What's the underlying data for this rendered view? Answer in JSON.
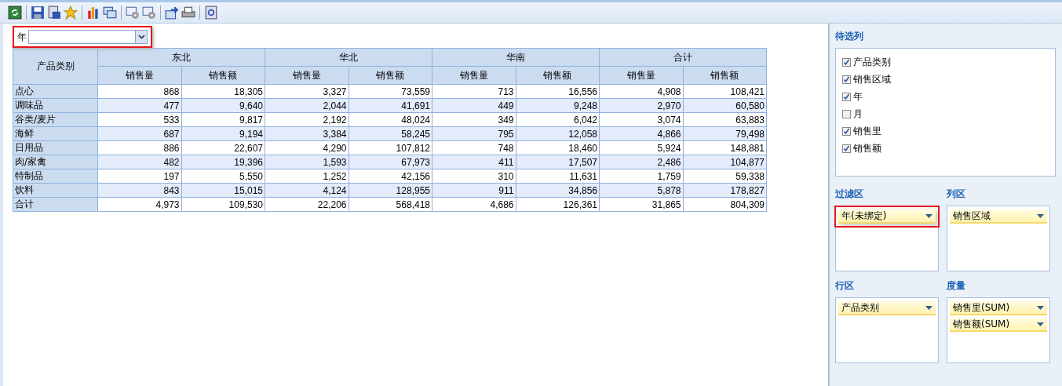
{
  "filter": {
    "label": "年",
    "highlighted": true
  },
  "table": {
    "corner": "产品类别",
    "groups": [
      {
        "label": "东北",
        "columns": [
          "销售量",
          "销售额"
        ]
      },
      {
        "label": "华北",
        "columns": [
          "销售量",
          "销售额"
        ]
      },
      {
        "label": "华南",
        "columns": [
          "销售量",
          "销售额"
        ]
      },
      {
        "label": "合计",
        "columns": [
          "销售量",
          "销售额"
        ]
      }
    ],
    "rows": [
      {
        "label": "点心",
        "cells": [
          "868",
          "18,305",
          "3,327",
          "73,559",
          "713",
          "16,556",
          "4,908",
          "108,421"
        ]
      },
      {
        "label": "调味品",
        "cells": [
          "477",
          "9,640",
          "2,044",
          "41,691",
          "449",
          "9,248",
          "2,970",
          "60,580"
        ]
      },
      {
        "label": "谷类/麦片",
        "cells": [
          "533",
          "9,817",
          "2,192",
          "48,024",
          "349",
          "6,042",
          "3,074",
          "63,883"
        ]
      },
      {
        "label": "海鲜",
        "cells": [
          "687",
          "9,194",
          "3,384",
          "58,245",
          "795",
          "12,058",
          "4,866",
          "79,498"
        ]
      },
      {
        "label": "日用品",
        "cells": [
          "886",
          "22,607",
          "4,290",
          "107,812",
          "748",
          "18,460",
          "5,924",
          "148,881"
        ]
      },
      {
        "label": "肉/家禽",
        "cells": [
          "482",
          "19,396",
          "1,593",
          "67,973",
          "411",
          "17,507",
          "2,486",
          "104,877"
        ]
      },
      {
        "label": "特制品",
        "cells": [
          "197",
          "5,550",
          "1,252",
          "42,156",
          "310",
          "11,631",
          "1,759",
          "59,338"
        ]
      },
      {
        "label": "饮料",
        "cells": [
          "843",
          "15,015",
          "4,124",
          "128,955",
          "911",
          "34,856",
          "5,878",
          "178,827"
        ]
      },
      {
        "label": "合计",
        "cells": [
          "4,973",
          "109,530",
          "22,206",
          "568,418",
          "4,686",
          "126,361",
          "31,865",
          "804,309"
        ]
      }
    ]
  },
  "fields": {
    "title": "待选列",
    "items": [
      {
        "label": "产品类别",
        "checked": true
      },
      {
        "label": "销售区域",
        "checked": true
      },
      {
        "label": "年",
        "checked": true
      },
      {
        "label": "月",
        "checked": false
      },
      {
        "label": "销售里",
        "checked": true
      },
      {
        "label": "销售额",
        "checked": true
      }
    ]
  },
  "zones": [
    {
      "title": "过滤区",
      "items": [
        {
          "label": "年(未绑定)",
          "highlighted": true
        }
      ]
    },
    {
      "title": "列区",
      "items": [
        {
          "label": "销售区域",
          "highlighted": false
        }
      ]
    },
    {
      "title": "行区",
      "items": [
        {
          "label": "产品类别",
          "highlighted": false
        }
      ]
    },
    {
      "title": "度量",
      "items": [
        {
          "label": "销售里(SUM)",
          "highlighted": false
        },
        {
          "label": "销售额(SUM)",
          "highlighted": false
        }
      ]
    }
  ]
}
